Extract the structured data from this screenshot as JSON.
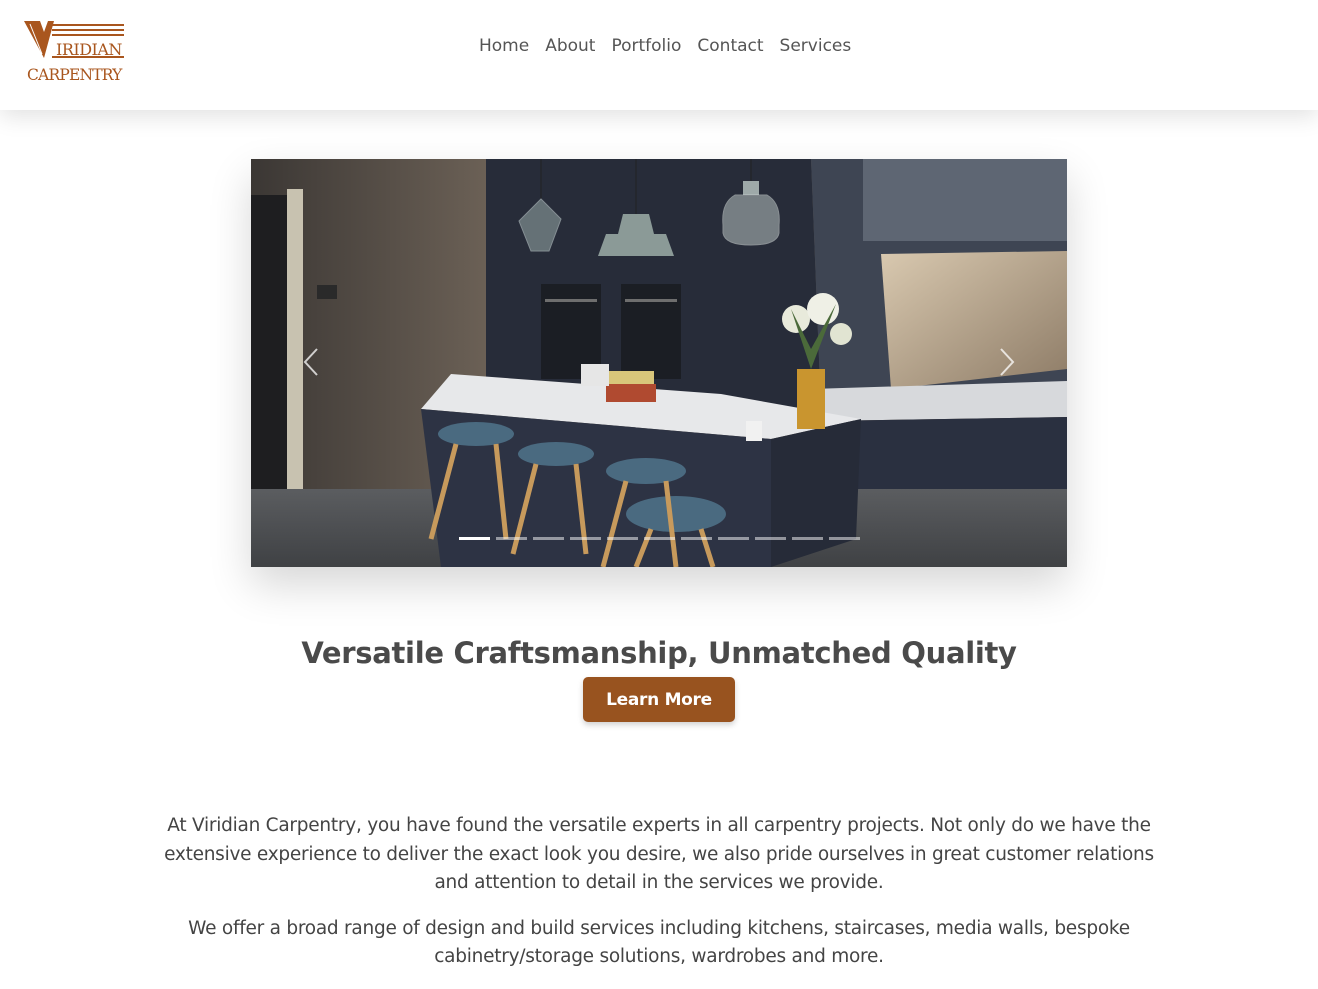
{
  "logo": {
    "top_text": "IRIDIAN",
    "bottom_text": "CARPENTRY",
    "brand_color": "#a9561e"
  },
  "nav": {
    "items": [
      "Home",
      "About",
      "Portfolio",
      "Contact",
      "Services"
    ]
  },
  "slider": {
    "prev_icon": "chevron-left-icon",
    "next_icon": "chevron-right-icon",
    "slide_count": 11,
    "active_index": 0
  },
  "hero": {
    "headline": "Versatile Craftsmanship, Unmatched Quality",
    "cta_label": "Learn More",
    "cta_color": "#98531f"
  },
  "intro": {
    "paragraphs": [
      "At Viridian Carpentry, you have found the versatile experts in all carpentry projects. Not only do we have the extensive experience to deliver the exact look you desire, we also pride ourselves in great customer relations and attention to detail in the services we provide.",
      "We offer a broad range of design and build services including kitchens, staircases, media walls, bespoke cabinetry/storage solutions, wardrobes and more."
    ]
  }
}
